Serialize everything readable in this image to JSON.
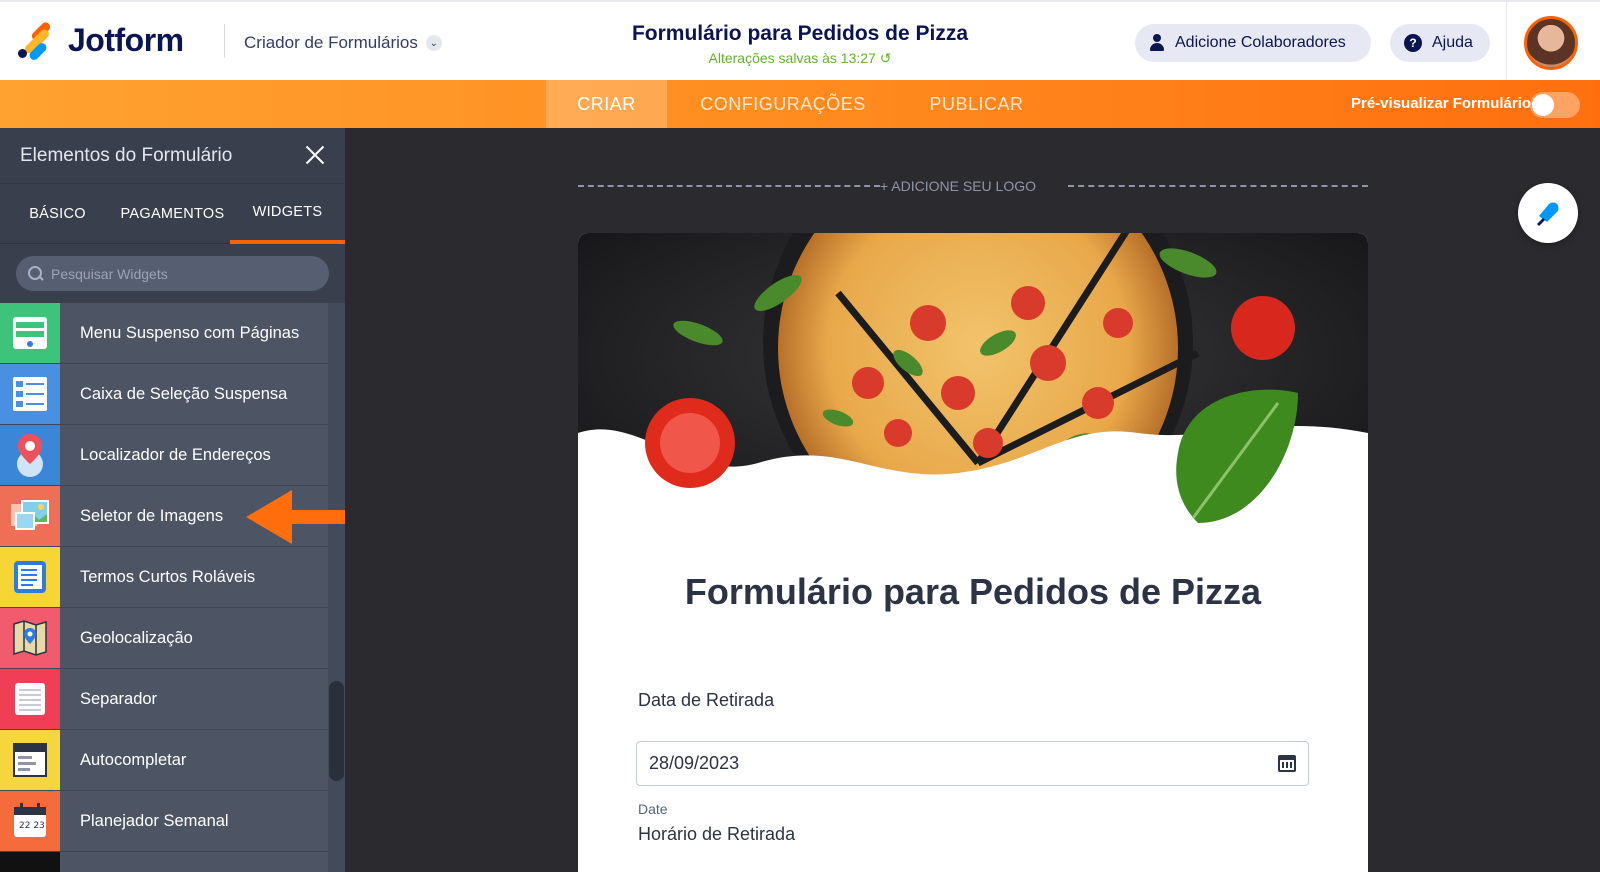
{
  "app": {
    "brand": "Jotform",
    "builder_menu": "Criador de Formulários",
    "form_title": "Formulário para Pedidos de Pizza",
    "saved_status": "Alterações salvas às 13:27",
    "add_collaborators": "Adicione Colaboradores",
    "help": "Ajuda"
  },
  "nav": {
    "tabs": [
      {
        "label": "CRIAR",
        "active": true
      },
      {
        "label": "CONFIGURAÇÕES",
        "active": false
      },
      {
        "label": "PUBLICAR",
        "active": false
      }
    ],
    "preview_label": "Pré-visualizar Formulário",
    "preview_enabled": false
  },
  "sidebar": {
    "title": "Elementos do Formulário",
    "tabs": [
      {
        "label": "BÁSICO",
        "active": false
      },
      {
        "label": "PAGAMENTOS",
        "active": false
      },
      {
        "label": "WIDGETS",
        "active": true
      }
    ],
    "search_placeholder": "Pesquisar Widgets",
    "widgets": [
      {
        "label": "Menu Suspenso com Páginas",
        "icon": "paged-dropdown-icon",
        "color": "#3ec47a"
      },
      {
        "label": "Caixa de Seleção Suspensa",
        "icon": "dropdown-checkbox-icon",
        "color": "#4a90e2"
      },
      {
        "label": "Localizador de Endereços",
        "icon": "map-pin-icon",
        "color": "#3b86d6"
      },
      {
        "label": "Seletor de Imagens",
        "icon": "image-picker-icon",
        "color": "#ee6f55"
      },
      {
        "label": "Termos Curtos Roláveis",
        "icon": "scroll-terms-icon",
        "color": "#f7d534"
      },
      {
        "label": "Geolocalização",
        "icon": "geolocation-map-icon",
        "color": "#f25a6e"
      },
      {
        "label": "Separador",
        "icon": "separator-icon",
        "color": "#ef3e56"
      },
      {
        "label": "Autocompletar",
        "icon": "autocomplete-icon",
        "color": "#f5d63d"
      },
      {
        "label": "Planejador Semanal",
        "icon": "calendar-icon",
        "color": "#f56b3b"
      }
    ]
  },
  "canvas": {
    "add_logo": "+ ADICIONE SEU LOGO",
    "form_heading": "Formulário para Pedidos de Pizza",
    "fields": [
      {
        "label": "Data de Retirada",
        "value": "28/09/2023",
        "sublabel": "Date"
      },
      {
        "label": "Horário de Retirada"
      }
    ]
  },
  "colors": {
    "accent": "#ff6100",
    "nav_gradient_start": "#ffa230",
    "nav_gradient_end": "#ff6f0f",
    "sidebar_bg": "#4d5565",
    "canvas_bg": "#2b2b2f",
    "saved_green": "#64b22e"
  }
}
